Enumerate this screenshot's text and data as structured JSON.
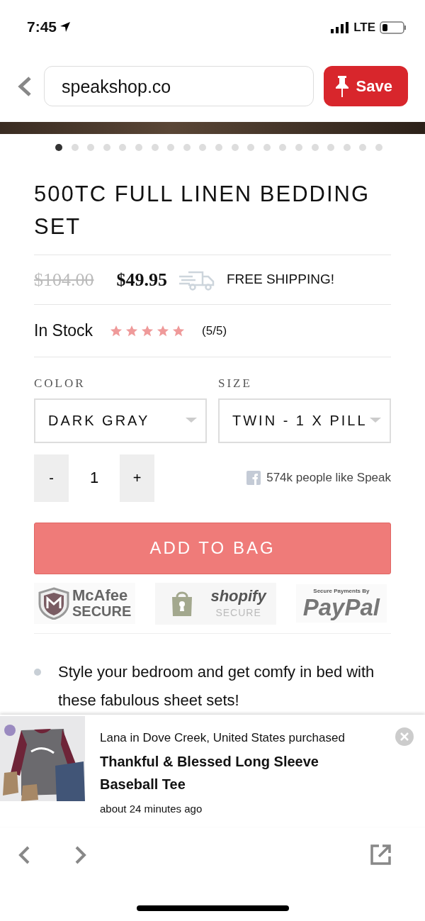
{
  "status_bar": {
    "time": "7:45",
    "network": "LTE"
  },
  "browser": {
    "url": "speakshop.co",
    "save_label": "Save"
  },
  "gallery": {
    "dots": [
      {
        "selected": true
      },
      {
        "selected": false
      },
      {
        "selected": false
      },
      {
        "selected": false
      },
      {
        "selected": false
      },
      {
        "selected": false
      },
      {
        "selected": false
      },
      {
        "selected": false
      },
      {
        "selected": false
      },
      {
        "selected": false
      },
      {
        "selected": false
      },
      {
        "selected": false
      },
      {
        "selected": false
      },
      {
        "selected": false
      },
      {
        "selected": false
      },
      {
        "selected": false
      },
      {
        "selected": false
      },
      {
        "selected": false
      },
      {
        "selected": false
      },
      {
        "selected": false
      },
      {
        "selected": false
      }
    ]
  },
  "product": {
    "title": "500TC FULL LINEN BEDDING SET",
    "old_price": "$104.00",
    "price": "$49.95",
    "shipping": "FREE SHIPPING!",
    "stock": "In Stock",
    "stars": 5,
    "rating": "(5/5)"
  },
  "options": [
    {
      "label": "COLOR",
      "value": "DARK GRAY"
    },
    {
      "label": "SIZE",
      "value": "TWIN - 1 X PILL"
    }
  ],
  "quantity": {
    "minus": "-",
    "value": "1",
    "plus": "+"
  },
  "facebook": "574k people like Speak",
  "add_button": "ADD TO BAG",
  "badges": [
    {
      "kind": "mcafee",
      "line1": "McAfee",
      "line2": "SECURE"
    },
    {
      "kind": "shopify",
      "line1": "shopify",
      "line2": "SECURE"
    },
    {
      "kind": "paypal",
      "line1": "Secure Payments By",
      "line2": "PayPal"
    }
  ],
  "bullets": [
    "Style your bedroom and get comfy in bed with these fabulous sheet sets!"
  ],
  "popup": {
    "message": "Lana in Dove Creek, United States purchased",
    "product": "Thankful & Blessed Long Sleeve Baseball Tee",
    "time": "about 24 minutes ago"
  }
}
